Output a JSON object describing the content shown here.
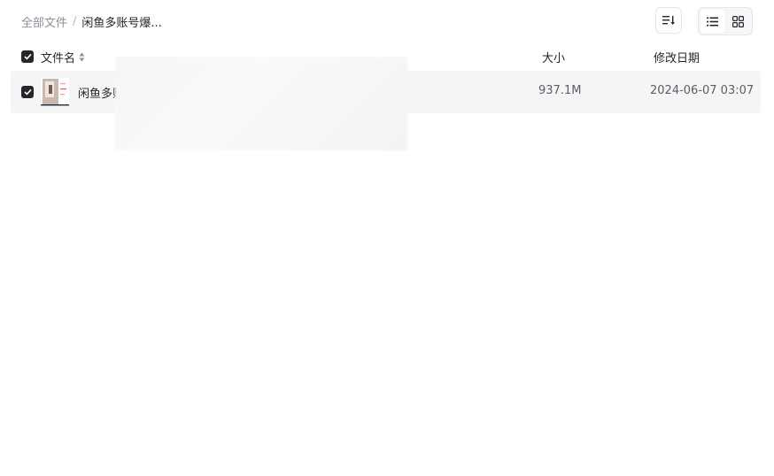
{
  "breadcrumb": {
    "root": "全部文件",
    "separator": "/",
    "current": "闲鱼多账号爆..."
  },
  "toolbar": {
    "sort_icon": "sort-lines-icon",
    "view_list_icon": "list-view-icon",
    "view_grid_icon": "grid-view-icon",
    "active_view": "list"
  },
  "table": {
    "columns": {
      "name": "文件名",
      "size": "大小",
      "date": "修改日期"
    },
    "header_checked": true,
    "rows": [
      {
        "checked": true,
        "name": "闲鱼多账",
        "size": "937.1M",
        "modified": "2024-06-07 03:07",
        "thumb_icon": "file-thumbnail-icon"
      }
    ]
  },
  "colors": {
    "text": "#25262b",
    "muted": "#8c8f99",
    "row_bg": "#f5f5f6",
    "border": "#e3e5ea"
  }
}
